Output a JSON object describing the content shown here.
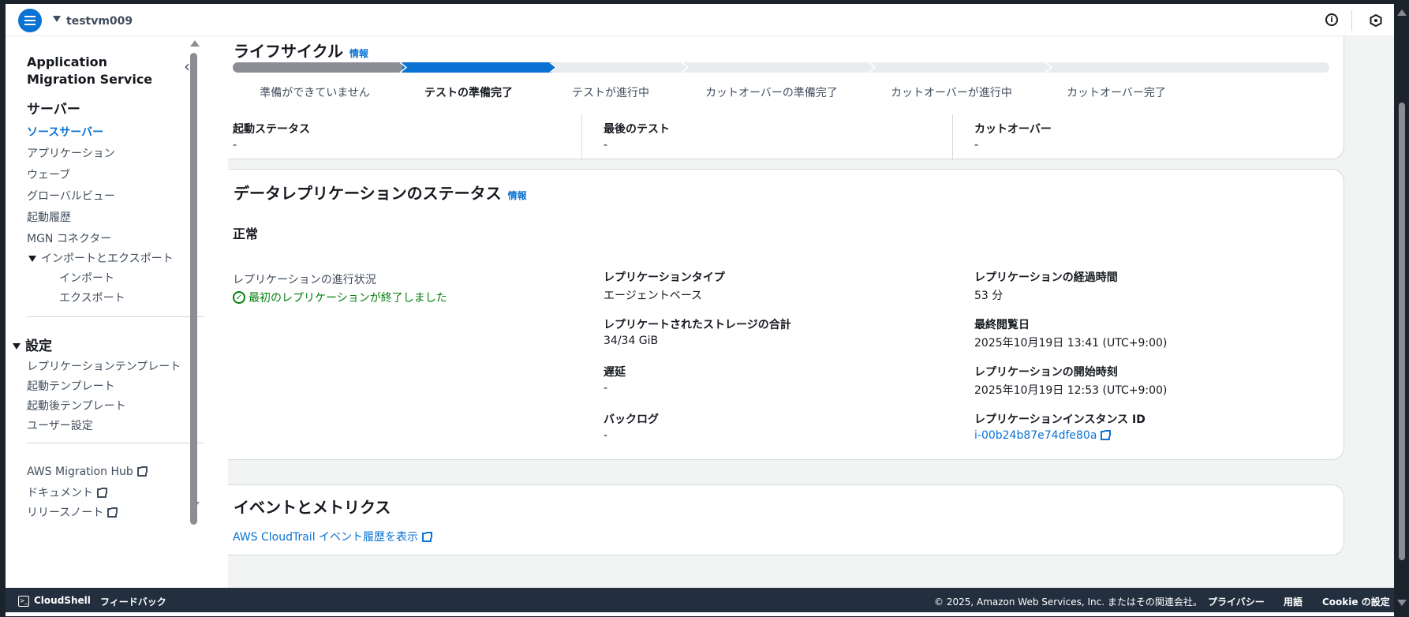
{
  "topbar": {
    "resource_name": "testvm009",
    "menu_icon": "hamburger-icon",
    "info_icon": "info-icon",
    "settings_icon": "hexagon-icon"
  },
  "sidebar": {
    "service_title": "Application Migration Service",
    "section_servers": "サーバー",
    "items": [
      {
        "label": "ソースサーバー"
      },
      {
        "label": "アプリケーション"
      },
      {
        "label": "ウェーブ"
      },
      {
        "label": "グローバルビュー"
      },
      {
        "label": "起動履歴"
      },
      {
        "label": "MGN コネクター"
      }
    ],
    "import_export": {
      "label": "インポートとエクスポート",
      "children": [
        {
          "label": "インポート"
        },
        {
          "label": "エクスポート"
        }
      ]
    },
    "section_settings": "設定",
    "settings_items": [
      {
        "label": "レプリケーションテンプレート"
      },
      {
        "label": "起動テンプレート"
      },
      {
        "label": "起動後テンプレート"
      },
      {
        "label": "ユーザー設定"
      }
    ],
    "external_links": [
      {
        "label": "AWS Migration Hub"
      },
      {
        "label": "ドキュメント"
      },
      {
        "label": "リリースノート"
      }
    ]
  },
  "lifecycle": {
    "title": "ライフサイクル",
    "info": "情報",
    "steps": [
      {
        "label": "準備ができていません"
      },
      {
        "label": "テストの準備完了"
      },
      {
        "label": "テストが進行中"
      },
      {
        "label": "カットオーバーの準備完了"
      },
      {
        "label": "カットオーバーが進行中"
      },
      {
        "label": "カットオーバー完了"
      }
    ],
    "current_step_index": 1,
    "launch_status_label": "起動ステータス",
    "launch_status_value": "-",
    "last_test_label": "最後のテスト",
    "last_test_value": "-",
    "cutover_label": "カットオーバー",
    "cutover_value": "-"
  },
  "replication": {
    "title": "データレプリケーションのステータス",
    "info": "情報",
    "health": "正常",
    "progress_label": "レプリケーションの進行状況",
    "progress_value": "最初のレプリケーションが終了しました",
    "type_label": "レプリケーションタイプ",
    "type_value": "エージェントベース",
    "storage_label": "レプリケートされたストレージの合計",
    "storage_value": "34/34 GiB",
    "lag_label": "遅延",
    "lag_value": "-",
    "backlog_label": "バックログ",
    "backlog_value": "-",
    "elapsed_label": "レプリケーションの経過時間",
    "elapsed_value": "53 分",
    "last_seen_label": "最終閲覧日",
    "last_seen_value": "2025年10月19日 13:41 (UTC+9:00)",
    "start_label": "レプリケーションの開始時刻",
    "start_value": "2025年10月19日 12:53 (UTC+9:00)",
    "instance_label": "レプリケーションインスタンス ID",
    "instance_value": "i-00b24b87e74dfe80a"
  },
  "events": {
    "title": "イベントとメトリクス",
    "cloudtrail_link": "AWS CloudTrail イベント履歴を表示"
  },
  "footer": {
    "cloudshell": "CloudShell",
    "feedback": "フィードバック",
    "copyright": "© 2025, Amazon Web Services, Inc. またはその関連会社。",
    "privacy": "プライバシー",
    "terms": "用語",
    "cookie": "Cookie の設定"
  },
  "colors": {
    "accent": "#0972d3",
    "success": "#037f0c",
    "completed_step": "#8c8c94",
    "footer_bg": "#232f3e"
  }
}
